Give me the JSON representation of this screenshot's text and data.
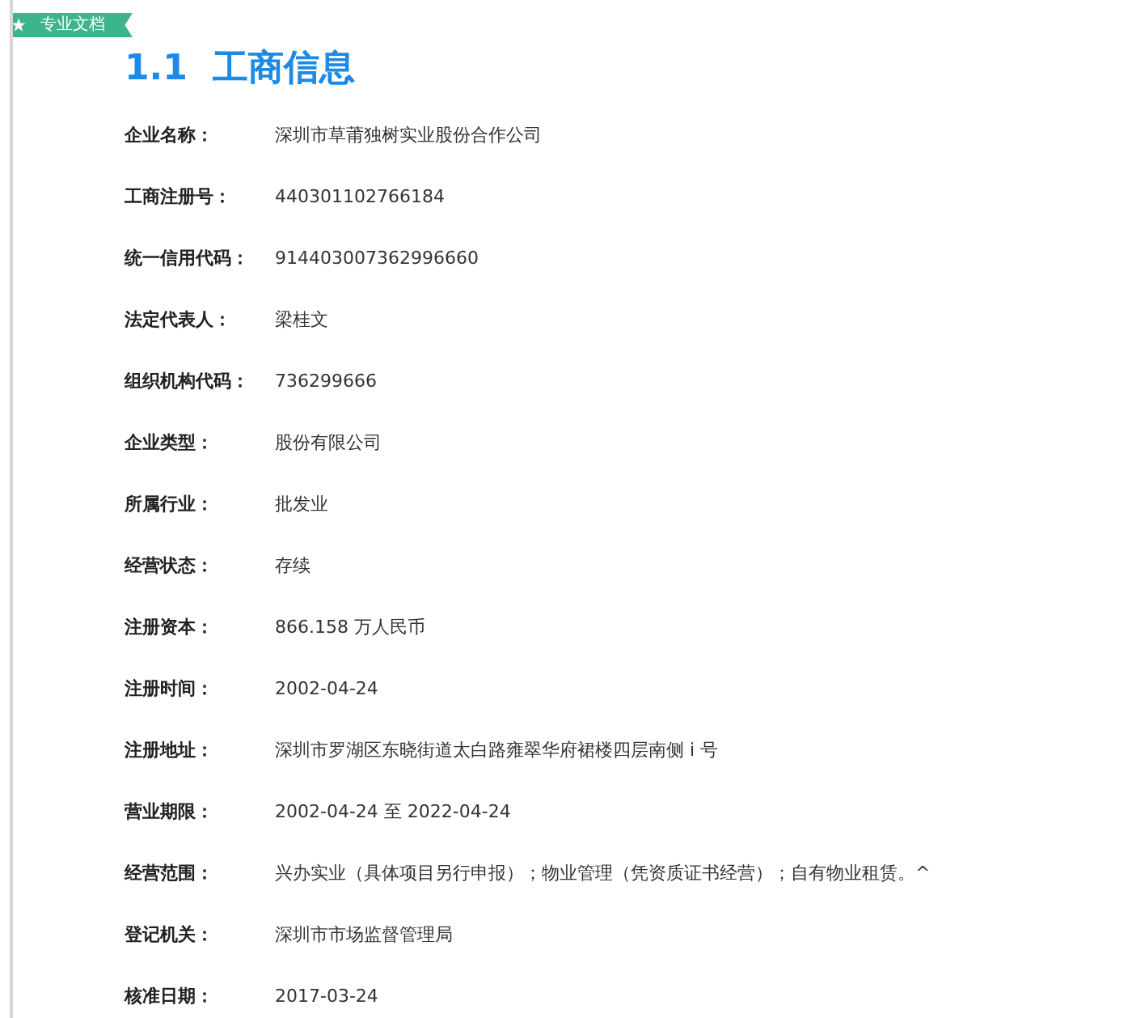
{
  "tag": {
    "label": "专业文档"
  },
  "heading": "1.1  工商信息",
  "fields": [
    {
      "label": "企业名称：",
      "value": "深圳市草莆独树实业股份合作公司"
    },
    {
      "label": "工商注册号：",
      "value": "440301102766184"
    },
    {
      "label": "统一信用代码：",
      "value": "914403007362996660"
    },
    {
      "label": "法定代表人：",
      "value": "梁桂文"
    },
    {
      "label": "组织机构代码：",
      "value": "736299666"
    },
    {
      "label": "企业类型：",
      "value": "股份有限公司"
    },
    {
      "label": "所属行业：",
      "value": "批发业"
    },
    {
      "label": "经营状态：",
      "value": "存续"
    },
    {
      "label": "注册资本：",
      "value": "866.158 万人民币"
    },
    {
      "label": "注册时间：",
      "value": "2002-04-24"
    },
    {
      "label": "注册地址：",
      "value": "深圳市罗湖区东晓街道太白路雍翠华府裙楼四层南侧 i 号"
    },
    {
      "label": "营业期限：",
      "value": "2002-04-24 至 2022-04-24"
    },
    {
      "label": "经营范围：",
      "value": "兴办实业（具体项目另行申报）；物业管理（凭资质证书经营）；自有物业租赁。^"
    },
    {
      "label": "登记机关：",
      "value": "深圳市市场监督管理局"
    },
    {
      "label": "核准日期：",
      "value": "2017-03-24"
    }
  ]
}
